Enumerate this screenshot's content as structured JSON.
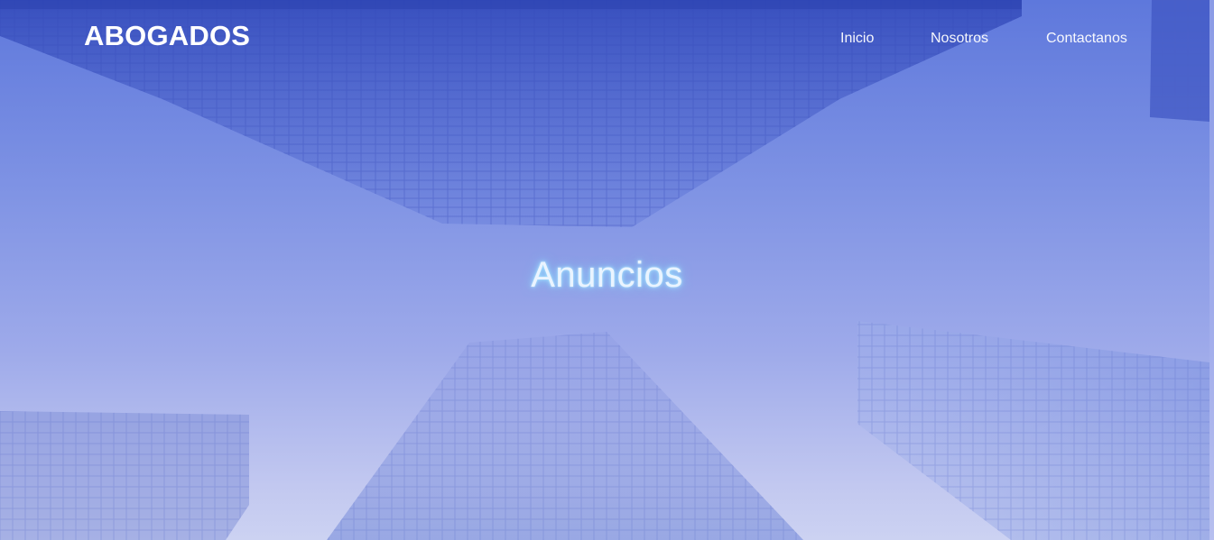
{
  "navbar": {
    "brand": "ABOGADOS",
    "links": [
      "Inicio",
      "Nosotros",
      "Contactanos"
    ]
  },
  "hero": {
    "title": "Anuncios"
  },
  "colors": {
    "overlay_top": "#5e78dc",
    "overlay_bottom": "#ccd2f2",
    "text": "#ffffff",
    "title_glow": "#9fe2ff"
  }
}
